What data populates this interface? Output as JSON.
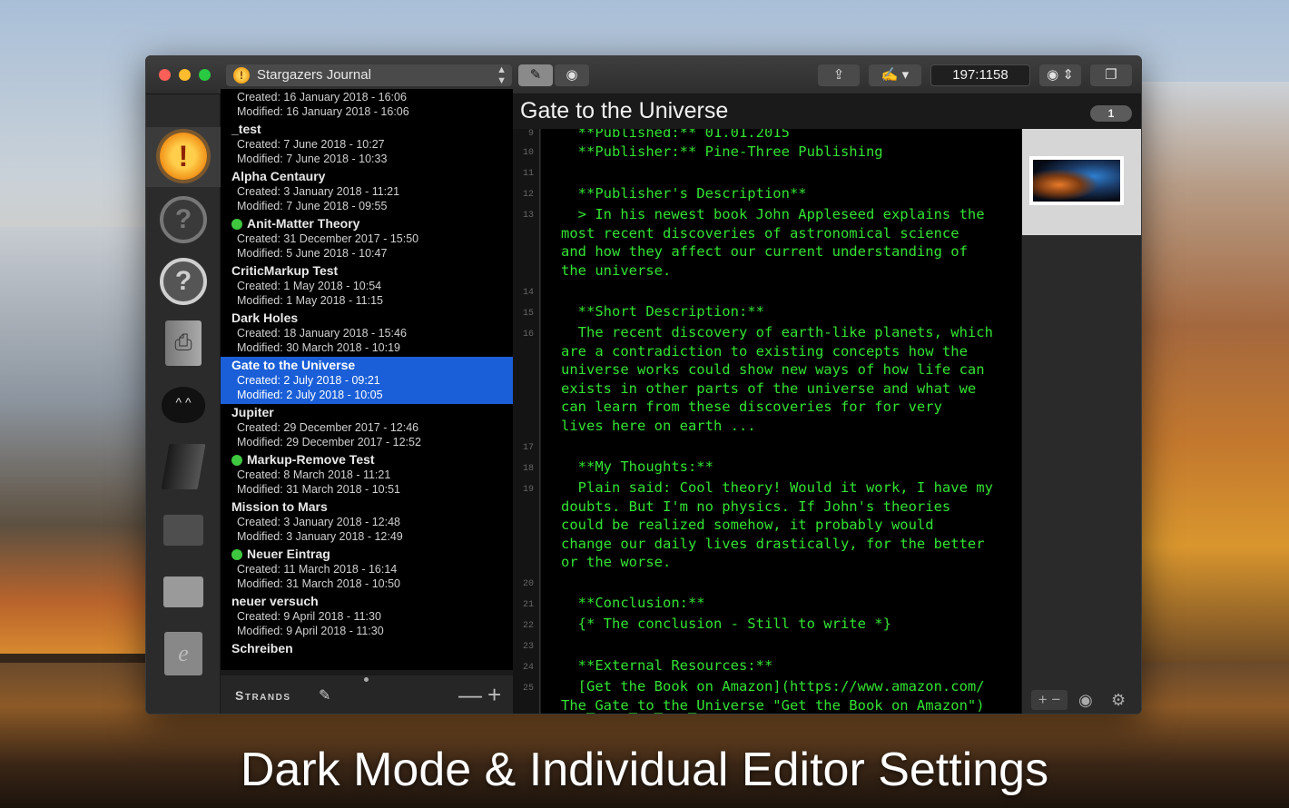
{
  "caption": "Dark Mode & Individual Editor Settings",
  "window": {
    "journal_name": "Stargazers Journal",
    "journal_icon": "!",
    "word_counter": "197:1158",
    "doc_title": "Gate to the Universe",
    "page_badge": "1",
    "icons": {
      "share": "share-icon",
      "edit": "edit-mode-icon",
      "preview": "eye-icon"
    }
  },
  "sidebar_icons": [
    {
      "name": "journal-sun-icon",
      "glyph": "!"
    },
    {
      "name": "journal-question-icon",
      "glyph": "?"
    },
    {
      "name": "journal-question-light-icon",
      "glyph": "?"
    },
    {
      "name": "journal-notebook-icon",
      "glyph": ""
    },
    {
      "name": "journal-cat-icon",
      "glyph": "^ ^"
    },
    {
      "name": "journal-slab-icon",
      "glyph": ""
    },
    {
      "name": "journal-folder-icon",
      "glyph": ""
    },
    {
      "name": "journal-folder-light-icon",
      "glyph": ""
    },
    {
      "name": "journal-e-icon",
      "glyph": "e"
    }
  ],
  "entries": [
    {
      "title": "",
      "created": "Created: 16 January 2018 - 16:06",
      "modified": "Modified: 16 January 2018 - 16:06",
      "dot": false
    },
    {
      "title": "_test",
      "created": "Created: 7 June 2018 - 10:27",
      "modified": "Modified: 7 June 2018 - 10:33",
      "dot": false
    },
    {
      "title": "Alpha Centaury",
      "created": "Created: 3 January 2018 - 11:21",
      "modified": "Modified: 7 June 2018 - 09:55",
      "dot": false
    },
    {
      "title": "Anit-Matter Theory",
      "created": "Created: 31 December 2017 - 15:50",
      "modified": "Modified: 5 June 2018 - 10:47",
      "dot": true
    },
    {
      "title": "CriticMarkup Test",
      "created": "Created: 1 May 2018 - 10:54",
      "modified": "Modified: 1 May 2018 - 11:15",
      "dot": false
    },
    {
      "title": "Dark Holes",
      "created": "Created: 18 January 2018 - 15:46",
      "modified": "Modified: 30 March 2018 - 10:19",
      "dot": false
    },
    {
      "title": "Gate to the Universe",
      "created": "Created: 2 July 2018 - 09:21",
      "modified": "Modified: 2 July 2018 - 10:05",
      "dot": false,
      "selected": true
    },
    {
      "title": "Jupiter",
      "created": "Created: 29 December 2017 - 12:46",
      "modified": "Modified: 29 December 2017 - 12:52",
      "dot": false
    },
    {
      "title": "Markup-Remove Test",
      "created": "Created: 8 March 2018 - 11:21",
      "modified": "Modified: 31 March 2018 - 10:51",
      "dot": true
    },
    {
      "title": "Mission to Mars",
      "created": "Created: 3 January 2018 - 12:48",
      "modified": "Modified: 3 January 2018 - 12:49",
      "dot": false
    },
    {
      "title": "Neuer Eintrag",
      "created": "Created: 11 March 2018 - 16:14",
      "modified": "Modified: 31 March 2018 - 10:50",
      "dot": true
    },
    {
      "title": "neuer versuch",
      "created": "Created: 9 April 2018 - 11:30",
      "modified": "Modified: 9 April 2018 - 11:30",
      "dot": false
    },
    {
      "title": "Schreiben",
      "created": "",
      "modified": "",
      "dot": false
    }
  ],
  "list_footer": {
    "label": "Strands",
    "minus": "—",
    "plus": "+"
  },
  "line_numbers": [
    "9",
    "10",
    "11",
    "12",
    "13",
    "14",
    "15",
    "16",
    "17",
    "18",
    "19",
    "20",
    "21",
    "22",
    "23",
    "24",
    "25"
  ],
  "editor": {
    "p0": "  **Published:** 01.01.2015",
    "p1": "  **Publisher:** Pine-Three Publishing",
    "p2": "  **Publisher's Description**",
    "p3": "  > In his newest book John Appleseed explains the\nmost recent discoveries of astronomical science\nand how they affect our current understanding of\nthe universe.",
    "p4": "  **Short Description:**",
    "p5": "  The recent discovery of earth-like planets, which\nare a contradiction to existing concepts how the\nuniverse works could show new ways of how life can\nexists in other parts of the universe and what we\ncan learn from these discoveries for for very\nlives here on earth ...",
    "p6": "  **My Thoughts:**",
    "p7": "  Plain said: Cool theory! Would it work, I have my\ndoubts. But I'm no physics. If John's theories\ncould be realized somehow, it probably would\nchange our daily lives drastically, for the better\nor the worse.",
    "p8": "  **Conclusion:**",
    "p9": "  {* The conclusion - Still to write *}",
    "p10": "  **External Resources:**",
    "p11": "  [Get the Book on Amazon](https://www.amazon.com/\nThe_Gate_to_the_Universe \"Get the Book on Amazon\")"
  },
  "colors": {
    "editor_text": "#33e233",
    "selection": "#1a5fd8",
    "status_dot": "#3fc83f"
  }
}
